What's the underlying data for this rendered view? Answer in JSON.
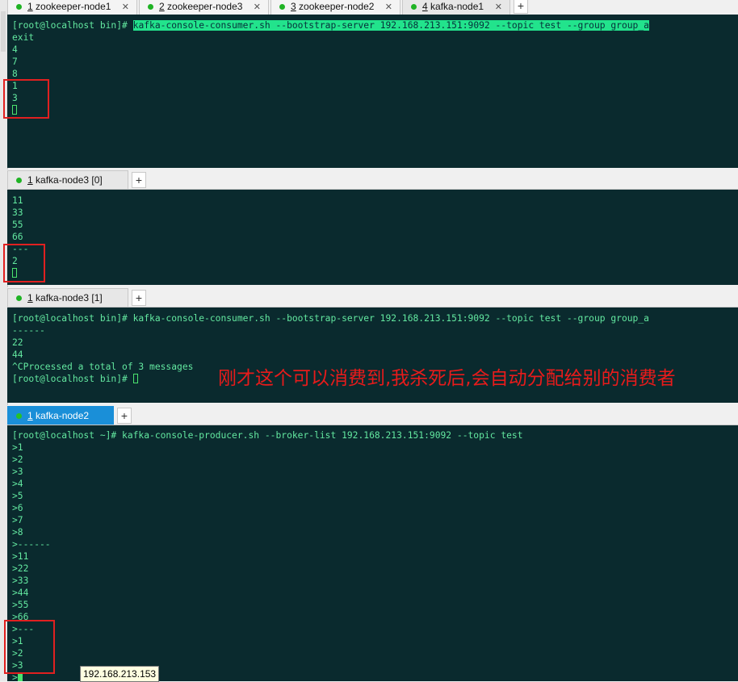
{
  "panes": [
    {
      "tabs": [
        {
          "num": "1",
          "label": "zookeeper-node1"
        },
        {
          "num": "2",
          "label": "zookeeper-node3"
        },
        {
          "num": "3",
          "label": "zookeeper-node2"
        },
        {
          "num": "4",
          "label": "kafka-node1"
        }
      ],
      "add_label": "+",
      "lines": [
        "[root@localhost bin]# ",
        "exit",
        "4",
        "7",
        "8",
        "1",
        "3"
      ],
      "command_highlighted": "kafka-console-consumer.sh --bootstrap-server 192.168.213.151:9092 --topic test --group group_a"
    },
    {
      "tabs": [
        {
          "num": "1",
          "label": "kafka-node3 [0]"
        }
      ],
      "add_label": "+",
      "lines": [
        "11",
        "33",
        "55",
        "66",
        "---",
        "2"
      ]
    },
    {
      "tabs": [
        {
          "num": "1",
          "label": "kafka-node3 [1]"
        }
      ],
      "add_label": "+",
      "lines": [
        "[root@localhost bin]# kafka-console-consumer.sh --bootstrap-server 192.168.213.151:9092 --topic test --group group_a",
        "------",
        "22",
        "44",
        "^CProcessed a total of 3 messages",
        "[root@localhost bin]# "
      ]
    },
    {
      "tabs": [
        {
          "num": "1",
          "label": "kafka-node2"
        }
      ],
      "add_label": "+",
      "lines": [
        "[root@localhost ~]# kafka-console-producer.sh --broker-list 192.168.213.151:9092 --topic test",
        ">1",
        ">2",
        ">3",
        ">4",
        ">5",
        ">6",
        ">7",
        ">8",
        ">------",
        ">11",
        ">22",
        ">33",
        ">44",
        ">55",
        ">66",
        ">---",
        ">1",
        ">2",
        ">3",
        ">"
      ]
    }
  ],
  "annotation": "刚才这个可以消费到,我杀死后,会自动分配给别的消费者",
  "tooltip": "192.168.213.153",
  "colors": {
    "terminal_bg": "#0a2a2e",
    "terminal_text": "#63e8a0",
    "highlight": "#22e38c",
    "annotation": "#e81b1b",
    "active_tab": "#1a8fd8"
  }
}
